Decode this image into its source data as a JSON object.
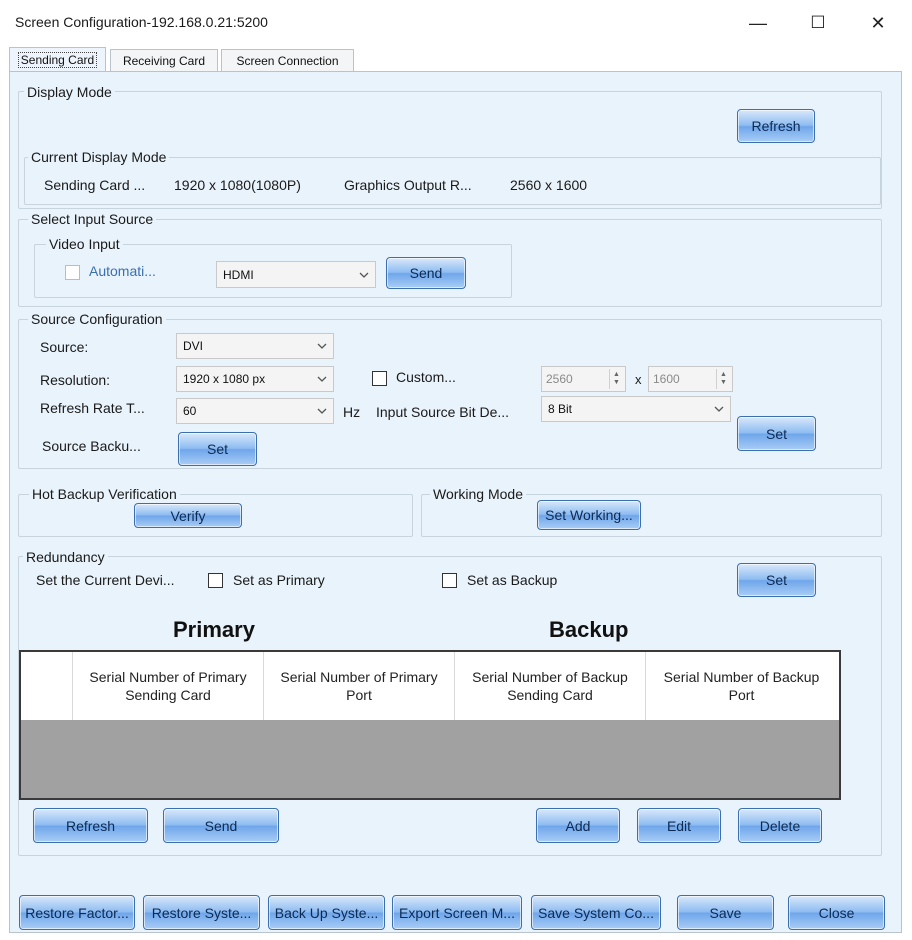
{
  "window": {
    "title": "Screen Configuration-192.168.0.21:5200",
    "minimize_glyph": "—",
    "maximize_glyph": "☐",
    "close_glyph": "✕"
  },
  "tabs": [
    {
      "label": "Sending Card",
      "active": true
    },
    {
      "label": "Receiving Card",
      "active": false
    },
    {
      "label": "Screen Connection",
      "active": false
    }
  ],
  "display_mode": {
    "legend": "Display Mode",
    "refresh_button": "Refresh",
    "current": {
      "legend": "Current Display Mode",
      "sending_card_label": "Sending Card ...",
      "sending_card_value": "1920 x 1080(1080P)",
      "graphics_label": "Graphics Output R...",
      "graphics_value": "2560 x 1600"
    }
  },
  "input_source": {
    "legend": "Select Input Source",
    "video_input_legend": "Video Input",
    "automatic_label": "Automati...",
    "automatic_checked": false,
    "source_selected": "HDMI",
    "send_button": "Send"
  },
  "source_config": {
    "legend": "Source Configuration",
    "source_label": "Source:",
    "source_value": "DVI",
    "resolution_label": "Resolution:",
    "resolution_value": "1920 x 1080 px",
    "custom_label": "Custom...",
    "custom_checked": false,
    "custom_width": "2560",
    "custom_x": "x",
    "custom_height": "1600",
    "refresh_rate_label": "Refresh Rate T...",
    "refresh_rate_value": "60",
    "hz_label": "Hz",
    "bit_depth_label": "Input Source Bit De...",
    "bit_depth_value": "8 Bit",
    "source_backup_label": "Source Backu...",
    "source_backup_button": "Set",
    "set_button": "Set"
  },
  "hot_backup": {
    "legend": "Hot Backup Verification",
    "verify_button": "Verify"
  },
  "working_mode": {
    "legend": "Working Mode",
    "set_working_button": "Set Working..."
  },
  "redundancy": {
    "legend": "Redundancy",
    "current_device_label": "Set the Current Devi...",
    "primary_label": "Set as Primary",
    "backup_label": "Set as Backup",
    "set_button": "Set",
    "primary_header": "Primary",
    "backup_header": "Backup",
    "columns": [
      "",
      "Serial Number of Primary Sending Card",
      "Serial Number of Primary Port",
      "Serial Number of Backup Sending Card",
      "Serial Number of Backup Port"
    ],
    "rows": [],
    "refresh_button": "Refresh",
    "send_button": "Send",
    "add_button": "Add",
    "edit_button": "Edit",
    "delete_button": "Delete"
  },
  "footer": {
    "restore_factory": "Restore Factor...",
    "restore_system": "Restore Syste...",
    "back_up_system": "Back Up Syste...",
    "export_screen": "Export Screen M...",
    "save_system_config": "Save System Co...",
    "save": "Save",
    "close": "Close"
  },
  "colors": {
    "panel_bg": "#e9f3fb",
    "button_blue": "#6fa6ea",
    "grid_bg": "#a1a1a1"
  }
}
